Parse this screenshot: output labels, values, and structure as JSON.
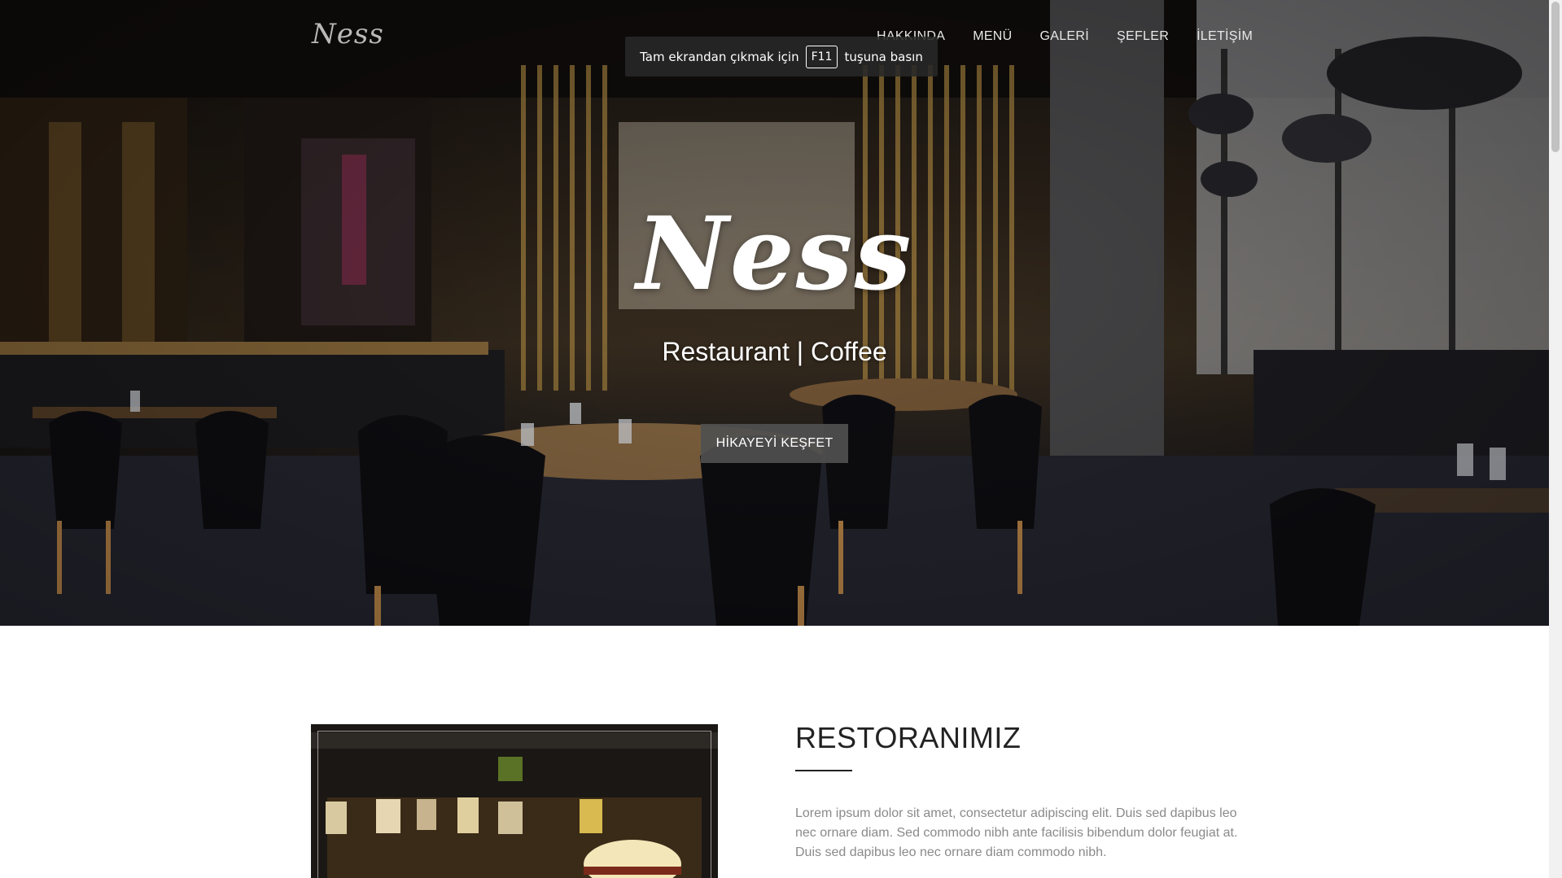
{
  "brand": {
    "logo_text": "Ness"
  },
  "nav": {
    "items": [
      {
        "label": "HAKKINDA"
      },
      {
        "label": "MENÜ"
      },
      {
        "label": "GALERİ"
      },
      {
        "label": "ŞEFLER"
      },
      {
        "label": "İLETİŞİM"
      }
    ]
  },
  "fullscreen_notice": {
    "before": "Tam ekrandan çıkmak için",
    "key": "F11",
    "after": "tuşuna basın"
  },
  "hero": {
    "title": "Ness",
    "subtitle": "Restaurant | Coffee",
    "cta_label": "HİKAYEYİ KEŞFET"
  },
  "about": {
    "title": "RESTORANIMIZ",
    "paragraph": "Lorem ipsum dolor sit amet, consectetur adipiscing elit. Duis sed dapibus leo nec ornare diam. Sed commodo nibh ante facilisis bibendum dolor feugiat at. Duis sed dapibus leo nec ornare diam commodo nibh."
  },
  "colors": {
    "accent_button": "#505050",
    "heading": "#222222",
    "body_text": "#8a8a8a"
  }
}
